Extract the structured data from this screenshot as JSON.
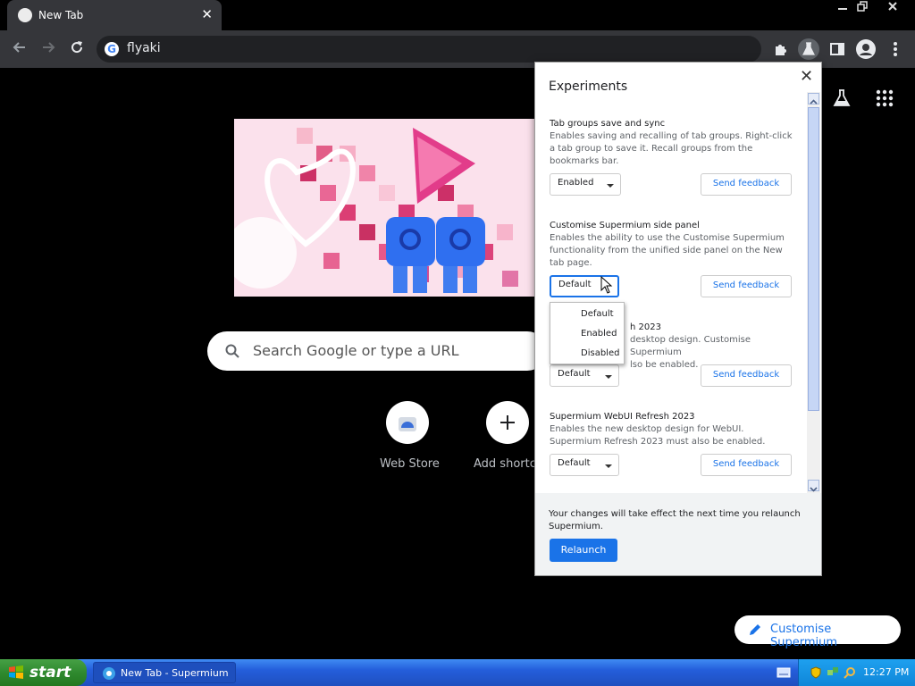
{
  "browser": {
    "tab_title": "New Tab",
    "address": "flyaki",
    "window_controls": [
      "minimize",
      "restore",
      "close"
    ]
  },
  "ntp": {
    "search_placeholder": "Search Google or type a URL",
    "shortcuts": [
      {
        "label": "Web Store",
        "icon": "webstore-icon"
      },
      {
        "label": "Add shortcu",
        "icon": "plus-icon"
      }
    ],
    "customise_label": "Customise Supermium"
  },
  "experiments": {
    "title": "Experiments",
    "items": [
      {
        "name": "Tab groups save and sync",
        "description": "Enables saving and recalling of tab groups. Right-click a tab group to save it. Recall groups from the bookmarks bar.",
        "value": "Enabled",
        "feedback": "Send feedback"
      },
      {
        "name": "Customise Supermium side panel",
        "description": "Enables the ability to use the Customise Supermium functionality from the unified side panel on the New tab page.",
        "value": "Default",
        "feedback": "Send feedback"
      },
      {
        "name": "h 2023",
        "description_lines": [
          "desktop design. Customise Supermium",
          "lso be enabled."
        ],
        "value": "Default",
        "feedback": "Send feedback"
      },
      {
        "name": "Supermium WebUI Refresh 2023",
        "description": "Enables the new desktop design for WebUI. Supermium Refresh 2023 must also be enabled.",
        "value": "Default",
        "feedback": "Send feedback"
      }
    ],
    "dropdown_options": [
      "Default",
      "Enabled",
      "Disabled"
    ],
    "footer_text": "Your changes will take effect the next time you relaunch Supermium.",
    "relaunch_label": "Relaunch"
  },
  "taskbar": {
    "start_label": "start",
    "task_label": "New Tab - Supermium",
    "clock": "12:27 PM"
  },
  "colors": {
    "accent": "#1a73e8",
    "toolbar": "#35363a",
    "taskbar": "#245edb",
    "start": "#2f8a2f"
  }
}
